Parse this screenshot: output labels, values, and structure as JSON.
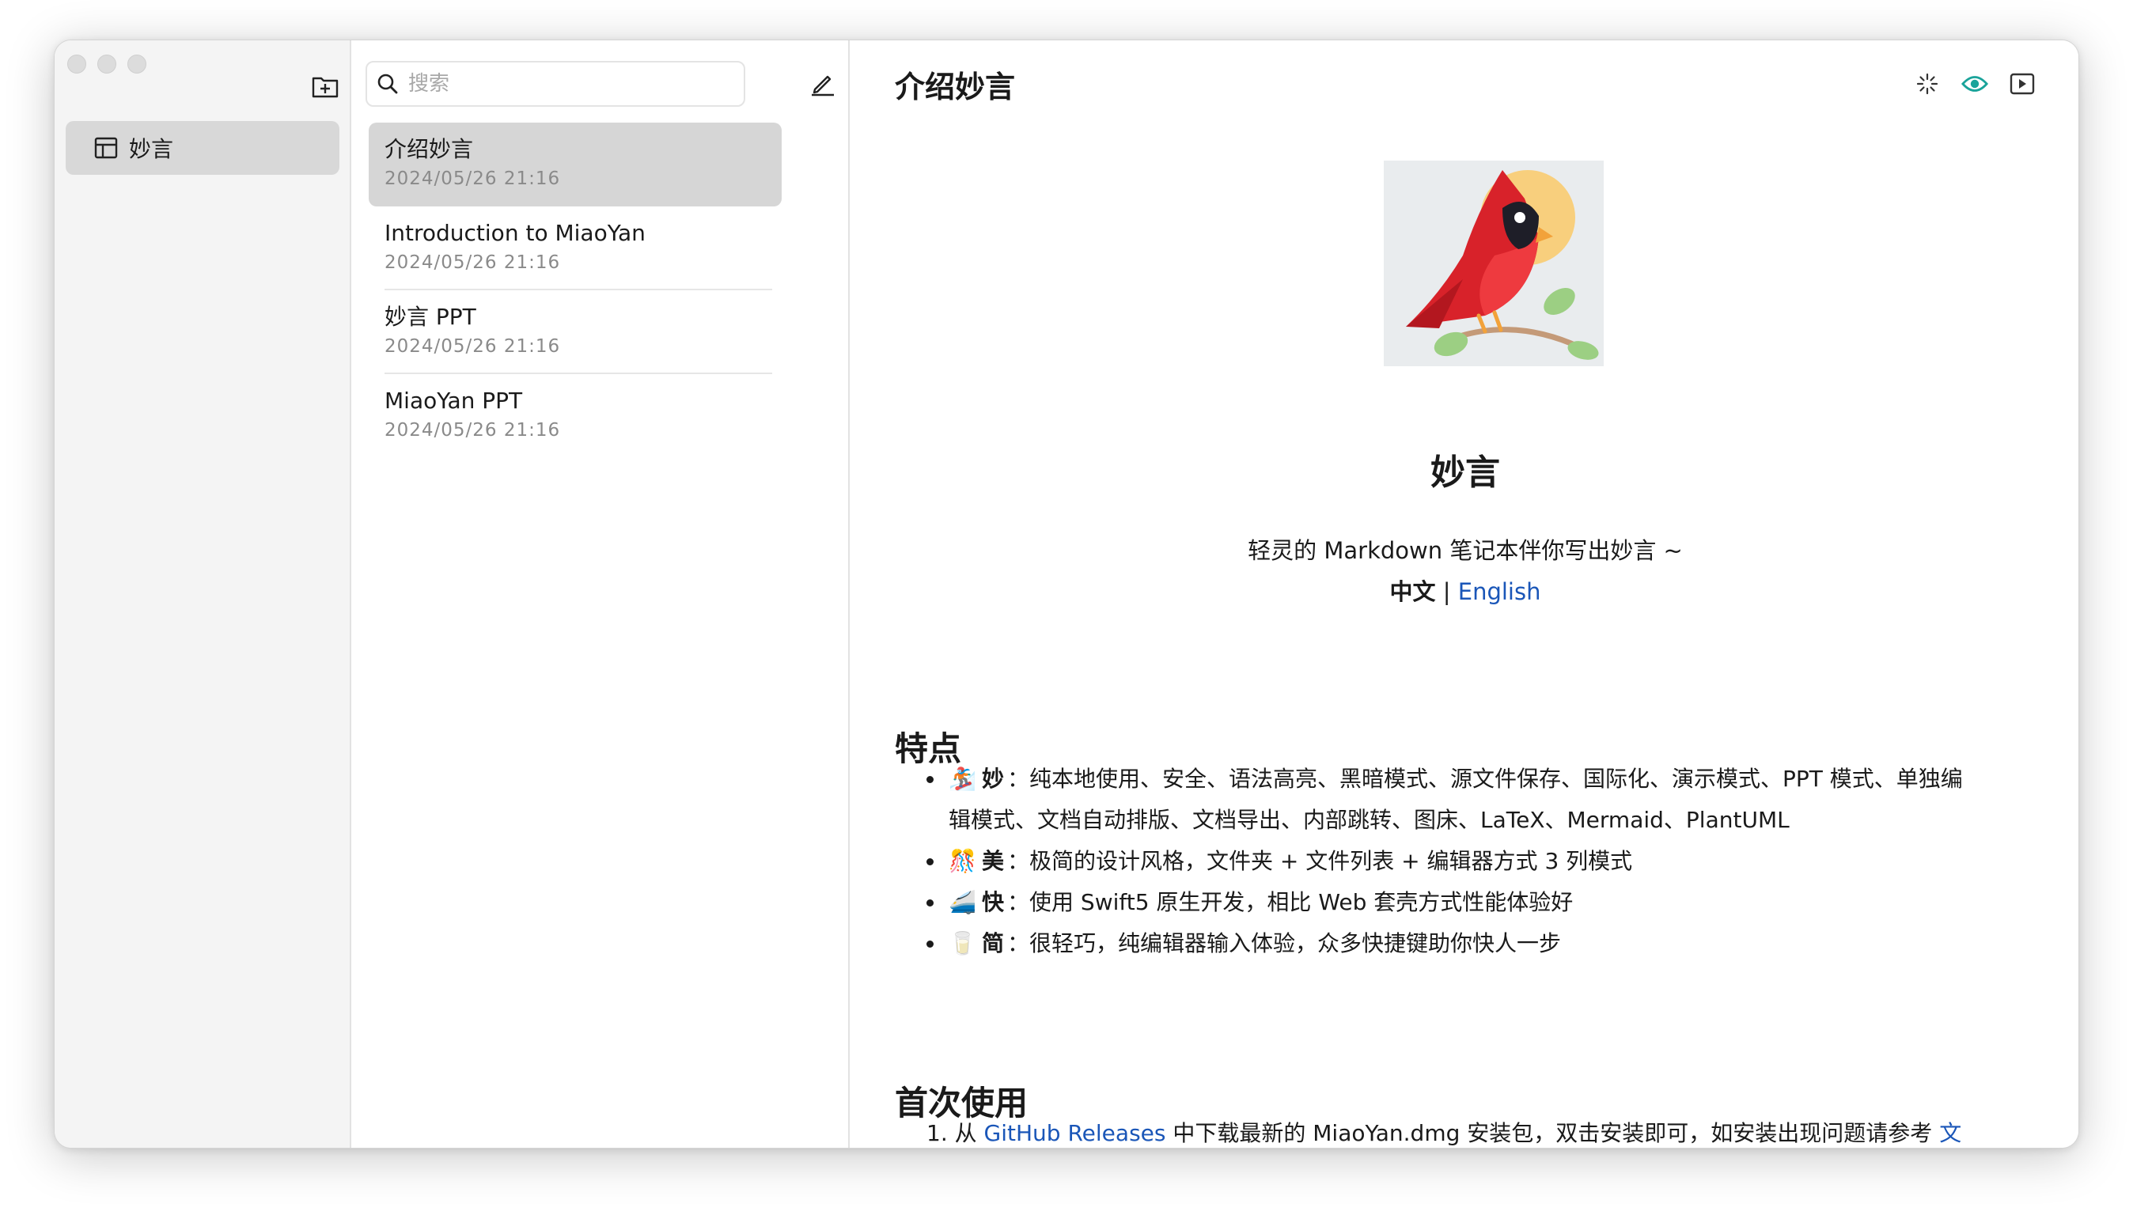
{
  "sidebar": {
    "folders": [
      {
        "label": "妙言"
      }
    ]
  },
  "notelist": {
    "search_placeholder": "搜索",
    "notes": [
      {
        "title": "介绍妙言",
        "date": "2024/05/26 21:16"
      },
      {
        "title": "Introduction to MiaoYan",
        "date": "2024/05/26 21:16"
      },
      {
        "title": "妙言 PPT",
        "date": "2024/05/26 21:16"
      },
      {
        "title": "MiaoYan PPT",
        "date": "2024/05/26 21:16"
      }
    ]
  },
  "editor": {
    "title": "介绍妙言",
    "toolbar_icons": [
      "sparkle-icon",
      "eye-icon",
      "play-icon"
    ],
    "accent_color": "#1aa39a",
    "link_color": "#1a56b8",
    "doc": {
      "brand": "妙言",
      "slogan": "轻灵的 Markdown 笔记本伴你写出妙言 ~",
      "lang_current": "中文",
      "lang_separator": "|",
      "lang_other": "English",
      "features_heading": "特点",
      "features": [
        {
          "emoji": "🏂",
          "name": "妙",
          "text": "：纯本地使用、安全、语法高亮、黑暗模式、源文件保存、国际化、演示模式、PPT 模式、单独编",
          "text2": "辑模式、文档自动排版、文档导出、内部跳转、图床、LaTeX、Mermaid、PlantUML"
        },
        {
          "emoji": "🎊",
          "name": "美",
          "text": "：极简的设计风格，文件夹 + 文件列表 + 编辑器方式 3 列模式"
        },
        {
          "emoji": "🚄",
          "name": "快",
          "text": "：使用 Swift5 原生开发，相比 Web 套壳方式性能体验好"
        },
        {
          "emoji": "🥛",
          "name": "简",
          "text": "：很轻巧，纯编辑器输入体验，众多快捷键助你快人一步"
        }
      ],
      "first_use_heading": "首次使用",
      "steps": [
        {
          "number": "1.",
          "pre": "从",
          "link": "GitHub Releases",
          "post": "中下载最新的 MiaoYan.dmg 安装包，双击安装即可，如安装出现问题请参考",
          "link2": "文"
        }
      ]
    }
  }
}
